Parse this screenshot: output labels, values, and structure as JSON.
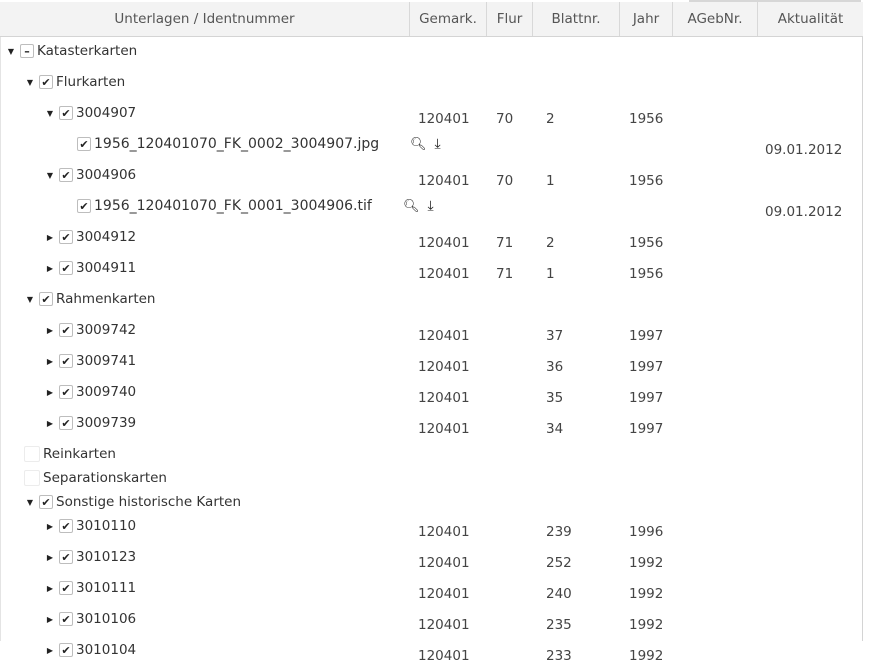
{
  "header": {
    "unterlagen": "Unterlagen / Identnummer",
    "gemark": "Gemark.",
    "flur": "Flur",
    "blattnr": "Blattnr.",
    "jahr": "Jahr",
    "agebnr": "AGebNr.",
    "aktualitaet": "Aktualität"
  },
  "rows": [
    {
      "level": 0,
      "expander": "expanded",
      "check": "partial",
      "label": "Katasterkarten",
      "gemark": "",
      "flur": "",
      "blattnr": "",
      "jahr": "",
      "aktualitaet": ""
    },
    {
      "level": 1,
      "expander": "expanded",
      "check": "checked",
      "label": "Flurkarten",
      "gemark": "",
      "flur": "",
      "blattnr": "",
      "jahr": "",
      "aktualitaet": ""
    },
    {
      "level": 2,
      "expander": "expanded",
      "check": "checked",
      "label": "3004907",
      "gemark": "120401",
      "flur": "70",
      "blattnr": "2",
      "jahr": "1956",
      "aktualitaet": ""
    },
    {
      "level": 3,
      "expander": "none",
      "check": "checked",
      "label": "1956_120401070_FK_0002_3004907.jpg",
      "file": true,
      "actions": [
        "search-icon",
        "download-icon"
      ],
      "gemark": "",
      "flur": "",
      "blattnr": "",
      "jahr": "",
      "aktualitaet": "09.01.2012"
    },
    {
      "level": 2,
      "expander": "expanded",
      "check": "checked",
      "label": "3004906",
      "gemark": "120401",
      "flur": "70",
      "blattnr": "1",
      "jahr": "1956",
      "aktualitaet": ""
    },
    {
      "level": 3,
      "expander": "none",
      "check": "checked",
      "label": "1956_120401070_FK_0001_3004906.tif",
      "file": true,
      "actions": [
        "search-icon",
        "download-icon"
      ],
      "gemark": "",
      "flur": "",
      "blattnr": "",
      "jahr": "",
      "aktualitaet": "09.01.2012"
    },
    {
      "level": 2,
      "expander": "collapsed",
      "check": "checked",
      "label": "3004912",
      "gemark": "120401",
      "flur": "71",
      "blattnr": "2",
      "jahr": "1956",
      "aktualitaet": ""
    },
    {
      "level": 2,
      "expander": "collapsed",
      "check": "checked",
      "label": "3004911",
      "gemark": "120401",
      "flur": "71",
      "blattnr": "1",
      "jahr": "1956",
      "aktualitaet": ""
    },
    {
      "level": 1,
      "expander": "expanded",
      "check": "checked",
      "label": "Rahmenkarten",
      "gemark": "",
      "flur": "",
      "blattnr": "",
      "jahr": "",
      "aktualitaet": ""
    },
    {
      "level": 2,
      "expander": "collapsed",
      "check": "checked",
      "label": "3009742",
      "gemark": "120401",
      "flur": "",
      "blattnr": "37",
      "jahr": "1997",
      "aktualitaet": ""
    },
    {
      "level": 2,
      "expander": "collapsed",
      "check": "checked",
      "label": "3009741",
      "gemark": "120401",
      "flur": "",
      "blattnr": "36",
      "jahr": "1997",
      "aktualitaet": ""
    },
    {
      "level": 2,
      "expander": "collapsed",
      "check": "checked",
      "label": "3009740",
      "gemark": "120401",
      "flur": "",
      "blattnr": "35",
      "jahr": "1997",
      "aktualitaet": ""
    },
    {
      "level": 2,
      "expander": "collapsed",
      "check": "checked",
      "label": "3009739",
      "gemark": "120401",
      "flur": "",
      "blattnr": "34",
      "jahr": "1997",
      "aktualitaet": ""
    },
    {
      "level": 1,
      "expander": "none",
      "check": "blank",
      "label": "Reinkarten",
      "compact": true,
      "gemark": "",
      "flur": "",
      "blattnr": "",
      "jahr": "",
      "aktualitaet": ""
    },
    {
      "level": 1,
      "expander": "none",
      "check": "blank",
      "label": "Separationskarten",
      "compact": true,
      "gemark": "",
      "flur": "",
      "blattnr": "",
      "jahr": "",
      "aktualitaet": ""
    },
    {
      "level": 1,
      "expander": "expanded",
      "check": "checked",
      "label": "Sonstige historische Karten",
      "compact": true,
      "gemark": "",
      "flur": "",
      "blattnr": "",
      "jahr": "",
      "aktualitaet": ""
    },
    {
      "level": 2,
      "expander": "collapsed",
      "check": "checked",
      "label": "3010110",
      "gemark": "120401",
      "flur": "",
      "blattnr": "239",
      "jahr": "1996",
      "aktualitaet": ""
    },
    {
      "level": 2,
      "expander": "collapsed",
      "check": "checked",
      "label": "3010123",
      "gemark": "120401",
      "flur": "",
      "blattnr": "252",
      "jahr": "1992",
      "aktualitaet": ""
    },
    {
      "level": 2,
      "expander": "collapsed",
      "check": "checked",
      "label": "3010111",
      "gemark": "120401",
      "flur": "",
      "blattnr": "240",
      "jahr": "1992",
      "aktualitaet": ""
    },
    {
      "level": 2,
      "expander": "collapsed",
      "check": "checked",
      "label": "3010106",
      "gemark": "120401",
      "flur": "",
      "blattnr": "235",
      "jahr": "1992",
      "aktualitaet": ""
    },
    {
      "level": 2,
      "expander": "collapsed",
      "check": "checked",
      "label": "3010104",
      "gemark": "120401",
      "flur": "",
      "blattnr": "233",
      "jahr": "1992",
      "aktualitaet": ""
    }
  ]
}
